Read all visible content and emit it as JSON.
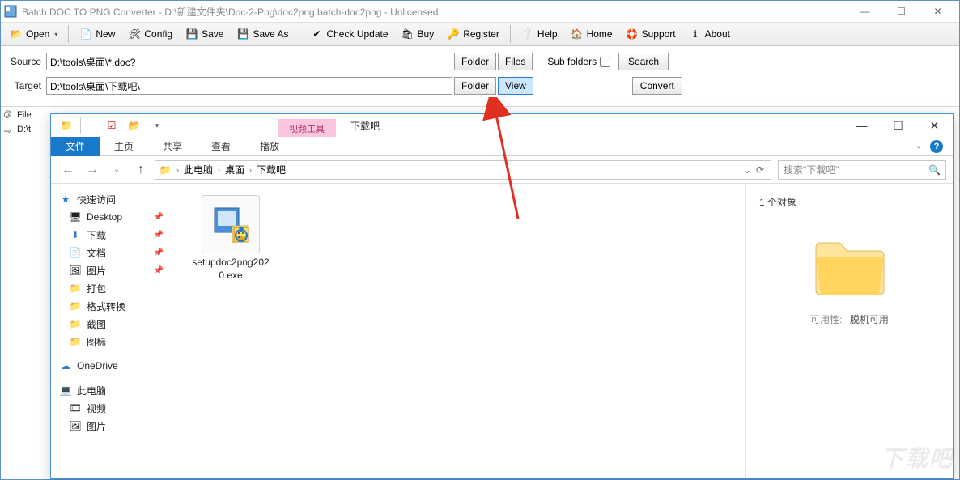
{
  "main": {
    "title": "Batch DOC TO PNG Converter - D:\\新建文件夹\\Doc-2-Png\\doc2png.batch-doc2png - Unlicensed",
    "toolbar": {
      "open": "Open",
      "new": "New",
      "config": "Config",
      "save": "Save",
      "saveas": "Save As",
      "check": "Check Update",
      "buy": "Buy",
      "register": "Register",
      "help": "Help",
      "home": "Home",
      "support": "Support",
      "about": "About"
    },
    "paths": {
      "source_label": "Source",
      "source_value": "D:\\tools\\桌面\\*.doc?",
      "target_label": "Target",
      "target_value": "D:\\tools\\桌面\\下载吧\\",
      "folder_btn": "Folder",
      "files_btn": "Files",
      "view_btn": "View",
      "subfolder_label": "Sub folders",
      "search_btn": "Search",
      "convert_btn": "Convert"
    },
    "side": {
      "at": "@",
      "arrow": "⇨",
      "file": "File",
      "drive": "D:\\t"
    }
  },
  "explorer": {
    "context_tab": "视频工具",
    "title": "下载吧",
    "ribbon": {
      "file": "文件",
      "home": "主页",
      "share": "共享",
      "view": "查看",
      "play": "播放"
    },
    "breadcrumb": {
      "pc": "此电脑",
      "desktop": "桌面",
      "folder": "下载吧"
    },
    "search_placeholder": "搜索\"下载吧\"",
    "nav": {
      "quick": "快速访问",
      "desktop": "Desktop",
      "downloads": "下载",
      "documents": "文档",
      "pictures": "图片",
      "pack": "打包",
      "format": "格式转换",
      "screenshot": "截图",
      "icons": "图标",
      "onedrive": "OneDrive",
      "thispc": "此电脑",
      "video": "视频",
      "pictures2": "图片"
    },
    "file": {
      "name": "setupdoc2png2020.exe"
    },
    "details": {
      "count": "1 个对象",
      "avail_label": "可用性:",
      "avail_value": "脱机可用"
    }
  },
  "watermark": "下载吧"
}
